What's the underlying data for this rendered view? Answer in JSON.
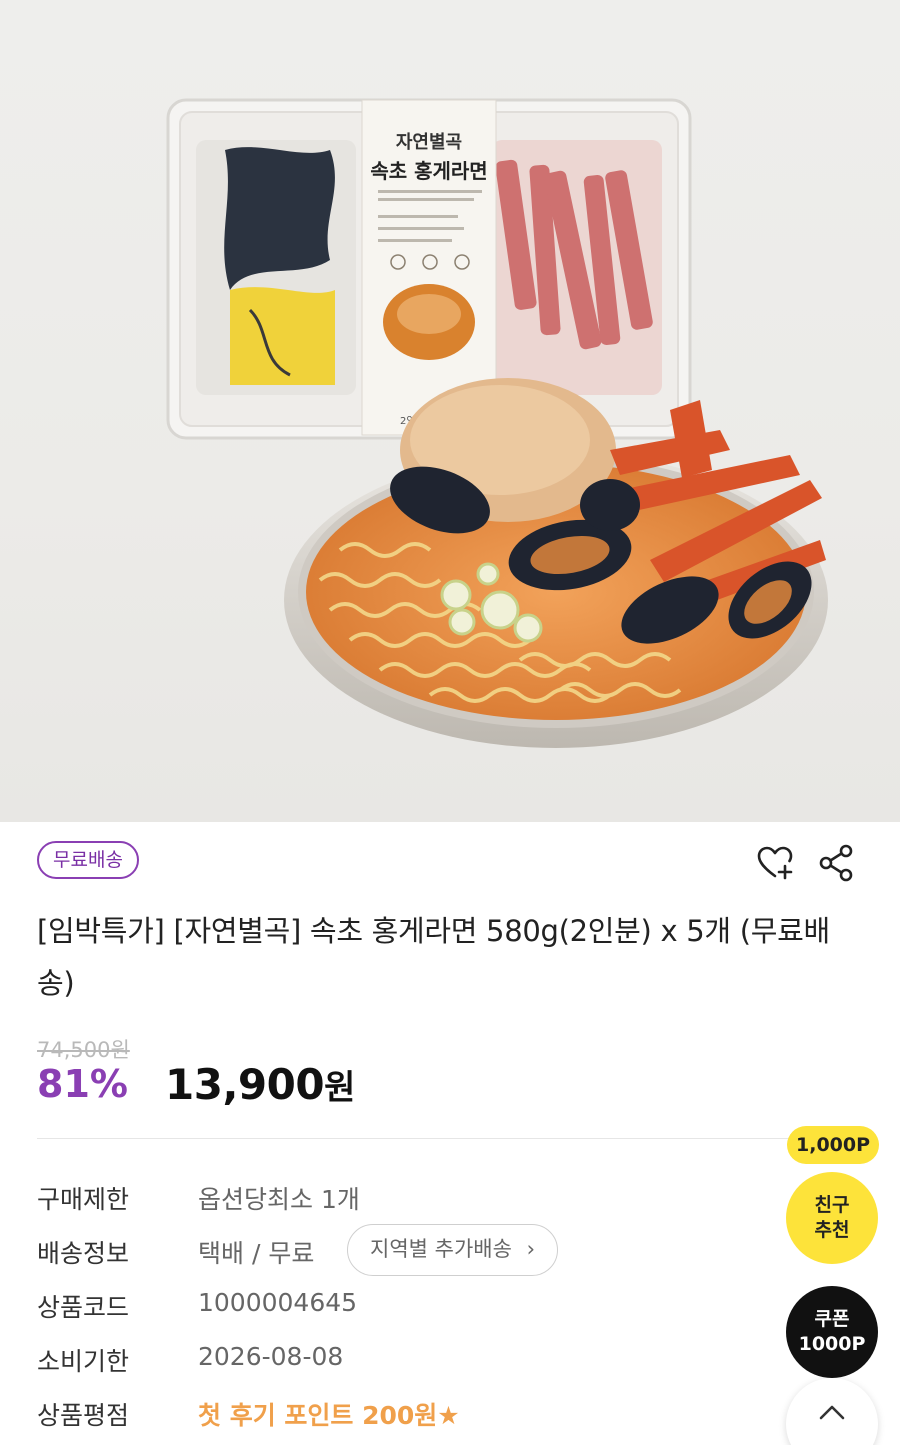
{
  "product_image": {
    "package_brand": "자연별곡",
    "package_name": "속초 홍게라면",
    "package_footer": "2인분 · 500",
    "package_marks": [
      "홍게",
      "라면"
    ]
  },
  "badge": {
    "label": "무료배송"
  },
  "actions": {
    "wishlist_icon": "heart-plus-icon",
    "share_icon": "share-icon"
  },
  "product": {
    "title": "[임박특가] [자연별곡] 속초 홍게라면 580g(2인분) x 5개 (무료배송)"
  },
  "pricing": {
    "original": "74,500원",
    "discount": "81%",
    "price": "13,900",
    "currency": "원"
  },
  "info": {
    "purchase_limit": {
      "label": "구매제한",
      "value": "옵션당최소 1개"
    },
    "shipping": {
      "label": "배송정보",
      "value": "택배 / 무료",
      "region_button": "지역별 추가배송",
      "region_icon": "chevron-right-icon"
    },
    "product_code": {
      "label": "상품코드",
      "value": "1000004645"
    },
    "expiry": {
      "label": "소비기한",
      "value": "2026-08-08"
    },
    "rating": {
      "label": "상품평점",
      "value": "첫 후기 포인트 200원★"
    }
  },
  "floating": {
    "points_tag": "1,000P",
    "friend_line1": "친구",
    "friend_line2": "추천",
    "coupon_line1": "쿠폰",
    "coupon_line2": "1000P",
    "scroll_top_icon": "chevron-up-icon"
  },
  "colors": {
    "accent_purple": "#8a3fb3",
    "price_black": "#111111",
    "point_yellow": "#fde33a",
    "highlight_orange": "#f0a04b"
  }
}
